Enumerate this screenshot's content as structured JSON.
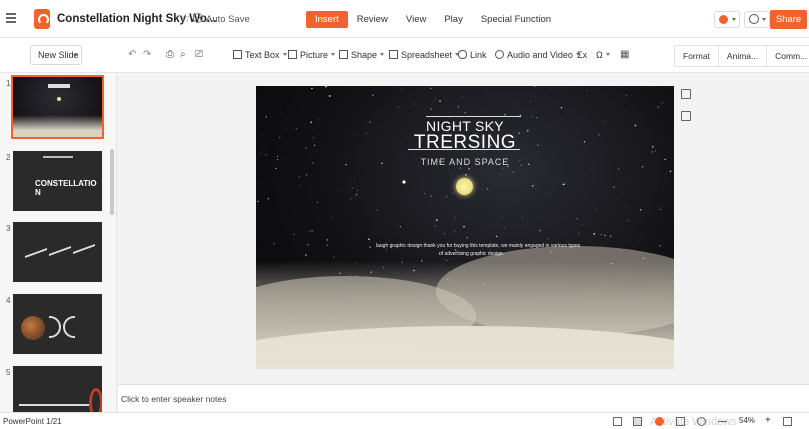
{
  "header": {
    "doc_title": "Constellation Night Sky Wo...",
    "autosave_label": "Auto Save",
    "tabs": [
      {
        "label": "Insert",
        "active": true
      },
      {
        "label": "Review",
        "active": false
      },
      {
        "label": "View",
        "active": false
      },
      {
        "label": "Play",
        "active": false
      },
      {
        "label": "Special Function",
        "active": false
      }
    ],
    "share_label": "Share",
    "accent_color": "#f1622e"
  },
  "toolbar": {
    "new_slide_label": "New Slide",
    "items": [
      {
        "label": "Text Box",
        "icon": "text-box-icon"
      },
      {
        "label": "Picture",
        "icon": "picture-icon"
      },
      {
        "label": "Shape",
        "icon": "shape-icon"
      },
      {
        "label": "Spreadsheet",
        "icon": "spreadsheet-icon"
      },
      {
        "label": "Link",
        "icon": "link-icon"
      },
      {
        "label": "Audio and Video",
        "icon": "audio-video-icon"
      }
    ],
    "formula_symbol": "Σx",
    "symbol_glyph": "Ω",
    "right_tabs": [
      "Format",
      "Anima...",
      "Comm..."
    ]
  },
  "slides_panel": {
    "slides": [
      {
        "num": "1",
        "selected": true,
        "title": ""
      },
      {
        "num": "2",
        "selected": false,
        "title": "CONSTELLATIO N"
      },
      {
        "num": "3",
        "selected": false,
        "title": ""
      },
      {
        "num": "4",
        "selected": false,
        "title": ""
      },
      {
        "num": "5",
        "selected": false,
        "title": ""
      }
    ]
  },
  "slide": {
    "title_line1": "NIGHT SKY",
    "title_line2": "TRERSING",
    "subtitle": "TIME AND SPACE",
    "body_line1": "laugh graphic design thank you for buying this template, we mainly engaged in various types",
    "body_line2": "of advertising graphic design."
  },
  "notes": {
    "placeholder": "Click to enter speaker notes"
  },
  "status": {
    "slide_counter": "PowerPoint 1/21",
    "zoom": "54%",
    "watermark": "Activate Windows"
  }
}
